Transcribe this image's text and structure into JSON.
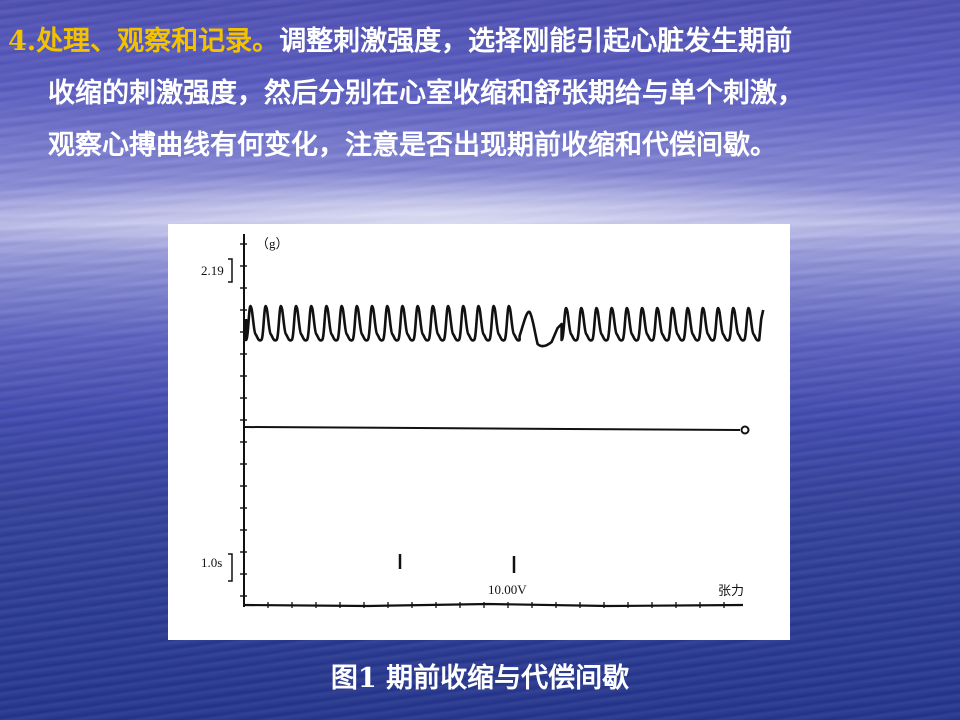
{
  "text": {
    "step_label": "4.处理、观察和记录。",
    "line1_rest": "调整刺激强度，选择刚能引起心脏发生期前",
    "line2": "收缩的刺激强度，然后分别在心室收缩和舒张期给与单个刺激，",
    "line3": "观察心搏曲线有何变化，注意是否出现期前收缩和代偿间歇。"
  },
  "figure": {
    "unit_label": "（g）",
    "scale_value": "2.19",
    "time_scale": "1.0s",
    "stimulus_voltage": "10.00V",
    "channel_label": "张力"
  },
  "caption": "图1 期前收缩与代偿间歇",
  "colors": {
    "highlight": "#f2c200",
    "text": "#ffffff",
    "trace": "#111111"
  }
}
